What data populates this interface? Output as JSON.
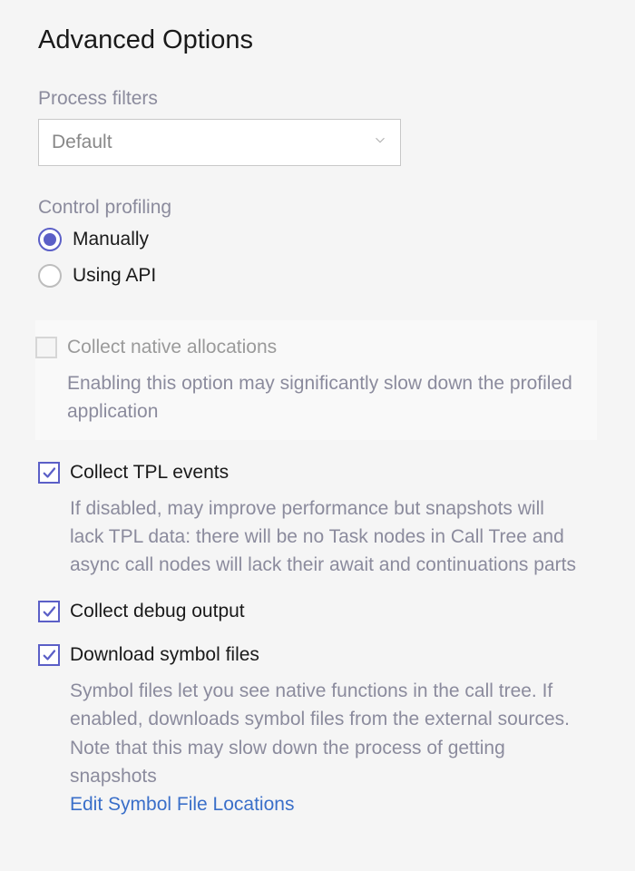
{
  "title": "Advanced Options",
  "processFilters": {
    "label": "Process filters",
    "selected": "Default"
  },
  "controlProfiling": {
    "label": "Control profiling",
    "options": [
      {
        "label": "Manually",
        "selected": true
      },
      {
        "label": "Using API",
        "selected": false
      }
    ]
  },
  "options": {
    "nativeAllocations": {
      "label": "Collect native allocations",
      "checked": false,
      "disabled": true,
      "description": "Enabling this option may significantly slow down the profiled application"
    },
    "tplEvents": {
      "label": "Collect TPL events",
      "checked": true,
      "description": "If disabled, may improve performance but snapshots will lack TPL data: there will be no Task nodes in Call Tree and async call nodes will lack their await and continuations parts"
    },
    "debugOutput": {
      "label": "Collect debug output",
      "checked": true
    },
    "symbolFiles": {
      "label": "Download symbol files",
      "checked": true,
      "description": "Symbol files let you see native functions in the call tree. If enabled, downloads symbol files from the external sources. Note that this may slow down the process of getting snapshots",
      "link": "Edit Symbol File Locations"
    }
  }
}
